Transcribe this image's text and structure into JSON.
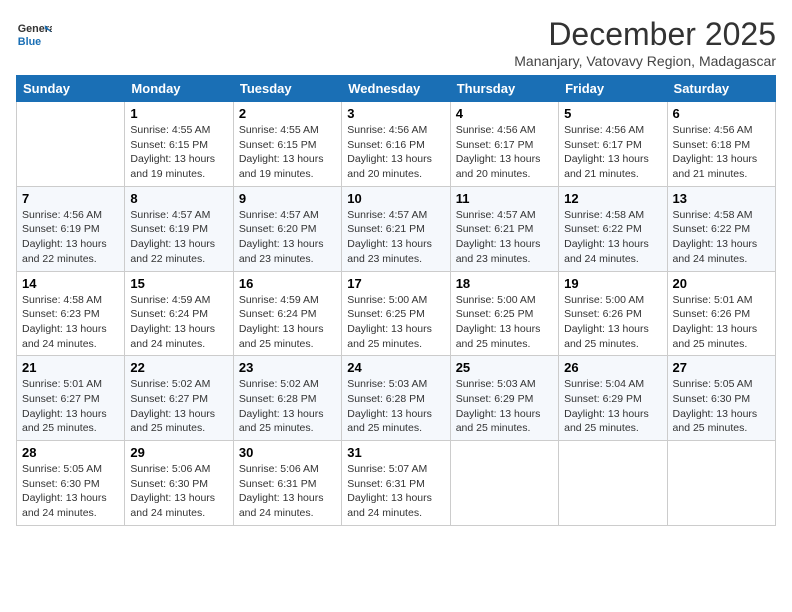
{
  "header": {
    "logo_general": "General",
    "logo_blue": "Blue",
    "month_year": "December 2025",
    "location": "Mananjary, Vatovavy Region, Madagascar"
  },
  "calendar": {
    "days_of_week": [
      "Sunday",
      "Monday",
      "Tuesday",
      "Wednesday",
      "Thursday",
      "Friday",
      "Saturday"
    ],
    "weeks": [
      [
        {
          "day": "",
          "details": ""
        },
        {
          "day": "1",
          "details": "Sunrise: 4:55 AM\nSunset: 6:15 PM\nDaylight: 13 hours\nand 19 minutes."
        },
        {
          "day": "2",
          "details": "Sunrise: 4:55 AM\nSunset: 6:15 PM\nDaylight: 13 hours\nand 19 minutes."
        },
        {
          "day": "3",
          "details": "Sunrise: 4:56 AM\nSunset: 6:16 PM\nDaylight: 13 hours\nand 20 minutes."
        },
        {
          "day": "4",
          "details": "Sunrise: 4:56 AM\nSunset: 6:17 PM\nDaylight: 13 hours\nand 20 minutes."
        },
        {
          "day": "5",
          "details": "Sunrise: 4:56 AM\nSunset: 6:17 PM\nDaylight: 13 hours\nand 21 minutes."
        },
        {
          "day": "6",
          "details": "Sunrise: 4:56 AM\nSunset: 6:18 PM\nDaylight: 13 hours\nand 21 minutes."
        }
      ],
      [
        {
          "day": "7",
          "details": "Sunrise: 4:56 AM\nSunset: 6:19 PM\nDaylight: 13 hours\nand 22 minutes."
        },
        {
          "day": "8",
          "details": "Sunrise: 4:57 AM\nSunset: 6:19 PM\nDaylight: 13 hours\nand 22 minutes."
        },
        {
          "day": "9",
          "details": "Sunrise: 4:57 AM\nSunset: 6:20 PM\nDaylight: 13 hours\nand 23 minutes."
        },
        {
          "day": "10",
          "details": "Sunrise: 4:57 AM\nSunset: 6:21 PM\nDaylight: 13 hours\nand 23 minutes."
        },
        {
          "day": "11",
          "details": "Sunrise: 4:57 AM\nSunset: 6:21 PM\nDaylight: 13 hours\nand 23 minutes."
        },
        {
          "day": "12",
          "details": "Sunrise: 4:58 AM\nSunset: 6:22 PM\nDaylight: 13 hours\nand 24 minutes."
        },
        {
          "day": "13",
          "details": "Sunrise: 4:58 AM\nSunset: 6:22 PM\nDaylight: 13 hours\nand 24 minutes."
        }
      ],
      [
        {
          "day": "14",
          "details": "Sunrise: 4:58 AM\nSunset: 6:23 PM\nDaylight: 13 hours\nand 24 minutes."
        },
        {
          "day": "15",
          "details": "Sunrise: 4:59 AM\nSunset: 6:24 PM\nDaylight: 13 hours\nand 24 minutes."
        },
        {
          "day": "16",
          "details": "Sunrise: 4:59 AM\nSunset: 6:24 PM\nDaylight: 13 hours\nand 25 minutes."
        },
        {
          "day": "17",
          "details": "Sunrise: 5:00 AM\nSunset: 6:25 PM\nDaylight: 13 hours\nand 25 minutes."
        },
        {
          "day": "18",
          "details": "Sunrise: 5:00 AM\nSunset: 6:25 PM\nDaylight: 13 hours\nand 25 minutes."
        },
        {
          "day": "19",
          "details": "Sunrise: 5:00 AM\nSunset: 6:26 PM\nDaylight: 13 hours\nand 25 minutes."
        },
        {
          "day": "20",
          "details": "Sunrise: 5:01 AM\nSunset: 6:26 PM\nDaylight: 13 hours\nand 25 minutes."
        }
      ],
      [
        {
          "day": "21",
          "details": "Sunrise: 5:01 AM\nSunset: 6:27 PM\nDaylight: 13 hours\nand 25 minutes."
        },
        {
          "day": "22",
          "details": "Sunrise: 5:02 AM\nSunset: 6:27 PM\nDaylight: 13 hours\nand 25 minutes."
        },
        {
          "day": "23",
          "details": "Sunrise: 5:02 AM\nSunset: 6:28 PM\nDaylight: 13 hours\nand 25 minutes."
        },
        {
          "day": "24",
          "details": "Sunrise: 5:03 AM\nSunset: 6:28 PM\nDaylight: 13 hours\nand 25 minutes."
        },
        {
          "day": "25",
          "details": "Sunrise: 5:03 AM\nSunset: 6:29 PM\nDaylight: 13 hours\nand 25 minutes."
        },
        {
          "day": "26",
          "details": "Sunrise: 5:04 AM\nSunset: 6:29 PM\nDaylight: 13 hours\nand 25 minutes."
        },
        {
          "day": "27",
          "details": "Sunrise: 5:05 AM\nSunset: 6:30 PM\nDaylight: 13 hours\nand 25 minutes."
        }
      ],
      [
        {
          "day": "28",
          "details": "Sunrise: 5:05 AM\nSunset: 6:30 PM\nDaylight: 13 hours\nand 24 minutes."
        },
        {
          "day": "29",
          "details": "Sunrise: 5:06 AM\nSunset: 6:30 PM\nDaylight: 13 hours\nand 24 minutes."
        },
        {
          "day": "30",
          "details": "Sunrise: 5:06 AM\nSunset: 6:31 PM\nDaylight: 13 hours\nand 24 minutes."
        },
        {
          "day": "31",
          "details": "Sunrise: 5:07 AM\nSunset: 6:31 PM\nDaylight: 13 hours\nand 24 minutes."
        },
        {
          "day": "",
          "details": ""
        },
        {
          "day": "",
          "details": ""
        },
        {
          "day": "",
          "details": ""
        }
      ]
    ]
  }
}
